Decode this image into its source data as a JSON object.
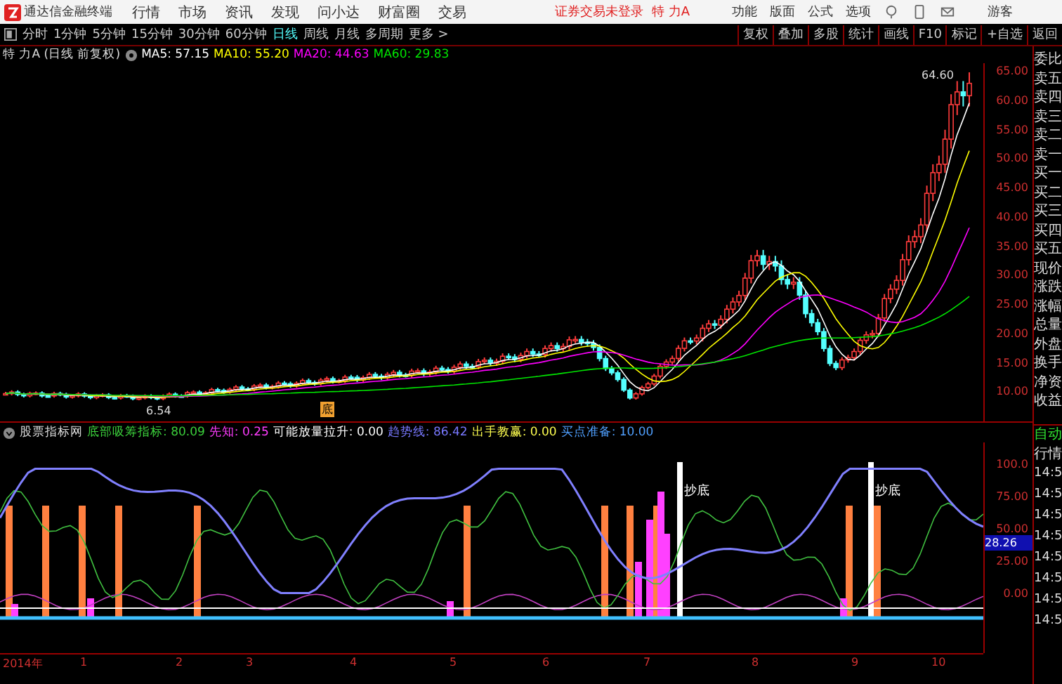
{
  "app": {
    "title": "通达信金融终端",
    "menu": [
      "行情",
      "市场",
      "资讯",
      "发现",
      "问小达",
      "财富圈",
      "交易"
    ],
    "notice": "证券交易未登录",
    "stock": "特 力A",
    "tools": [
      "功能",
      "版面",
      "公式",
      "选项"
    ],
    "user": "游客"
  },
  "periods": [
    {
      "label": "分时",
      "selected": false
    },
    {
      "label": "1分钟",
      "selected": false
    },
    {
      "label": "5分钟",
      "selected": false
    },
    {
      "label": "15分钟",
      "selected": false
    },
    {
      "label": "30分钟",
      "selected": false
    },
    {
      "label": "60分钟",
      "selected": false
    },
    {
      "label": "日线",
      "selected": true
    },
    {
      "label": "周线",
      "selected": false
    },
    {
      "label": "月线",
      "selected": false
    },
    {
      "label": "多周期",
      "selected": false
    },
    {
      "label": "更多 >",
      "selected": false
    }
  ],
  "actions": [
    "复权",
    "叠加",
    "多股",
    "统计",
    "画线",
    "F10",
    "标记",
    "+自选",
    "返回"
  ],
  "main": {
    "title": "特 力A (日线 前复权)",
    "ma": [
      {
        "label": "MA5: 57.15",
        "color": "#ffffff"
      },
      {
        "label": "MA10: 55.20",
        "color": "#ffff00"
      },
      {
        "label": "MA20: 44.63",
        "color": "#ff00ff"
      },
      {
        "label": "MA60: 29.83",
        "color": "#00e600"
      }
    ],
    "price_axis": [
      "65.00",
      "60.00",
      "55.00",
      "50.00",
      "45.00",
      "40.00",
      "35.00",
      "30.00",
      "25.00",
      "20.00",
      "15.00",
      "10.00"
    ],
    "high_label": "64.60",
    "low_label": "6.54",
    "marker": "底"
  },
  "indicator": {
    "name": "股票指标网",
    "lines": [
      {
        "label": "底部吸筹指标: 80.09",
        "color": "#3cd23c"
      },
      {
        "label": "先知: 0.25",
        "color": "#ff3cff"
      },
      {
        "label": "可能放量拉升: 0.00",
        "color": "#ffffff"
      },
      {
        "label": "趋势线: 86.42",
        "color": "#7878ff"
      },
      {
        "label": "出手教赢: 0.00",
        "color": "#ffff50"
      },
      {
        "label": "买点准备: 10.00",
        "color": "#50a0ff"
      }
    ],
    "axis": [
      "100.0",
      "75.00",
      "50.00",
      "25.00",
      "0.00"
    ],
    "current": "28.26",
    "signals": [
      "抄底",
      "抄底"
    ]
  },
  "dates": [
    "2014年",
    "1",
    "2",
    "3",
    "4",
    "5",
    "6",
    "7",
    "8",
    "9",
    "10"
  ],
  "quote_panel": {
    "labels": [
      "委比",
      "卖五",
      "卖四",
      "卖三",
      "卖二",
      "卖一",
      "买一",
      "买二",
      "买三",
      "买四",
      "买五",
      "现价",
      "涨跌",
      "涨幅",
      "总量",
      "外盘",
      "换手",
      "净资",
      "收益"
    ],
    "mode": "自动",
    "tab": "行情",
    "times": [
      "14:5",
      "14:5",
      "14:5",
      "14:5",
      "14:5",
      "14:5",
      "14:5",
      "14:5"
    ]
  }
}
